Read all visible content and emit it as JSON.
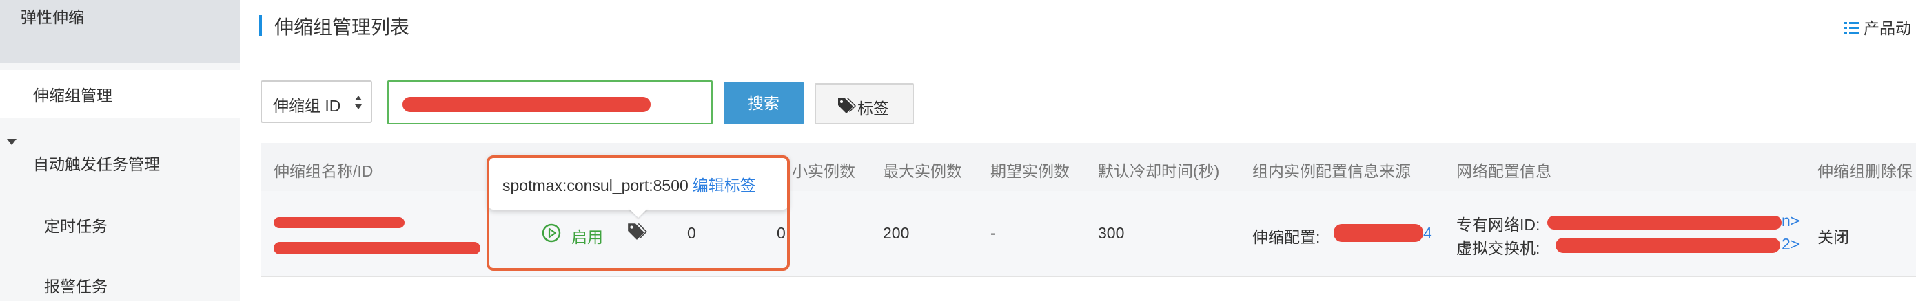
{
  "sidebar": {
    "title": "弹性伸缩",
    "items": [
      {
        "label": "伸缩组管理"
      },
      {
        "label": "自动触发任务管理"
      },
      {
        "label": "定时任务"
      },
      {
        "label": "报警任务"
      }
    ]
  },
  "header": {
    "title": "伸缩组管理列表",
    "product_link": "产品动"
  },
  "toolbar": {
    "search_field": "伸缩组 ID",
    "search_button": "搜索",
    "tag_button": "标签"
  },
  "table": {
    "columns": [
      "伸缩组名称/ID",
      "小实例数",
      "最大实例数",
      "期望实例数",
      "默认冷却时间(秒)",
      "组内实例配置信息来源",
      "网络配置信息",
      "伸缩组删除保"
    ],
    "row": {
      "status": "启用",
      "min_instances": "0",
      "current_instances": "0",
      "max_instances": "200",
      "desired_instances": "-",
      "cooldown": "300",
      "config_source_label": "伸缩配置:",
      "config_source_tail": "4",
      "vpc_label": "专有网络ID:",
      "vpc_tail": "n>",
      "vswitch_label": "虚拟交换机:",
      "vswitch_tail": "2>",
      "delete_protection": "关闭"
    }
  },
  "tooltip": {
    "tag_text": "spotmax:consul_port:8500",
    "edit_label": "编辑标签"
  },
  "colors": {
    "accent_blue": "#3f98d2",
    "link_blue": "#2d7fe0",
    "status_green": "#3fa33f",
    "highlight_orange": "#e8663c",
    "redaction_red": "#e8463c"
  }
}
